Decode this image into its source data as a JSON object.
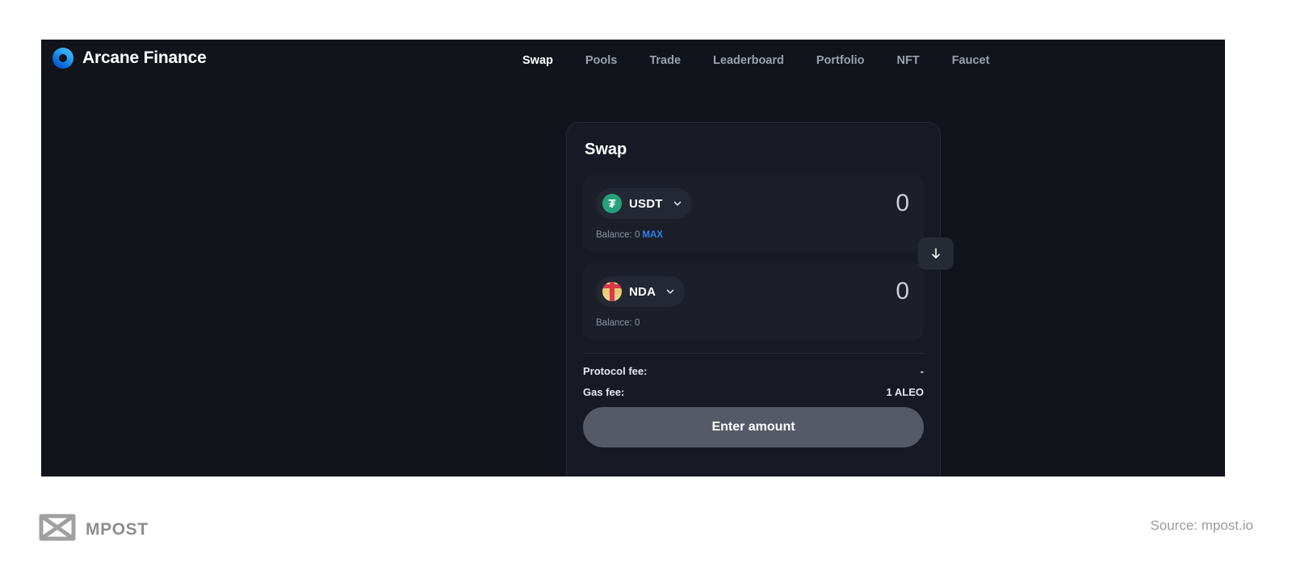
{
  "app": {
    "brand": {
      "name": "Arcane Finance",
      "logo_icon": "arcane-ring-logo",
      "logo_color": "#2196f3"
    },
    "nav": {
      "items": [
        {
          "label": "Swap",
          "active": true
        },
        {
          "label": "Pools",
          "active": false
        },
        {
          "label": "Trade",
          "active": false
        },
        {
          "label": "Leaderboard",
          "active": false
        },
        {
          "label": "Portfolio",
          "active": false
        },
        {
          "label": "NFT",
          "active": false
        },
        {
          "label": "Faucet",
          "active": false
        }
      ]
    },
    "swap_card": {
      "title": "Swap",
      "from": {
        "token_symbol": "USDT",
        "token_icon": "usdt-tether-icon",
        "token_glyph": "₮",
        "amount": "0",
        "balance_label": "Balance: 0",
        "max_label": "MAX"
      },
      "to": {
        "token_symbol": "NDA",
        "token_icon": "nda-token-icon",
        "amount": "0",
        "balance_label": "Balance: 0"
      },
      "switch_icon": "arrow-down-icon",
      "fees": [
        {
          "label": "Protocol fee:",
          "value": "-"
        },
        {
          "label": "Gas fee:",
          "value": "1 ALEO"
        }
      ],
      "cta_label": "Enter amount"
    },
    "colors": {
      "page_background": "#12141c",
      "card_background": "#171a24",
      "panel_background": "#1c1f2a",
      "accent_blue": "#2f80ed",
      "usdt_green": "#26a17b",
      "cta_gray": "#565a66"
    }
  },
  "footer": {
    "logo_text": "MPOST",
    "logo_icon": "mpost-logo",
    "source": "Source: mpost.io"
  }
}
